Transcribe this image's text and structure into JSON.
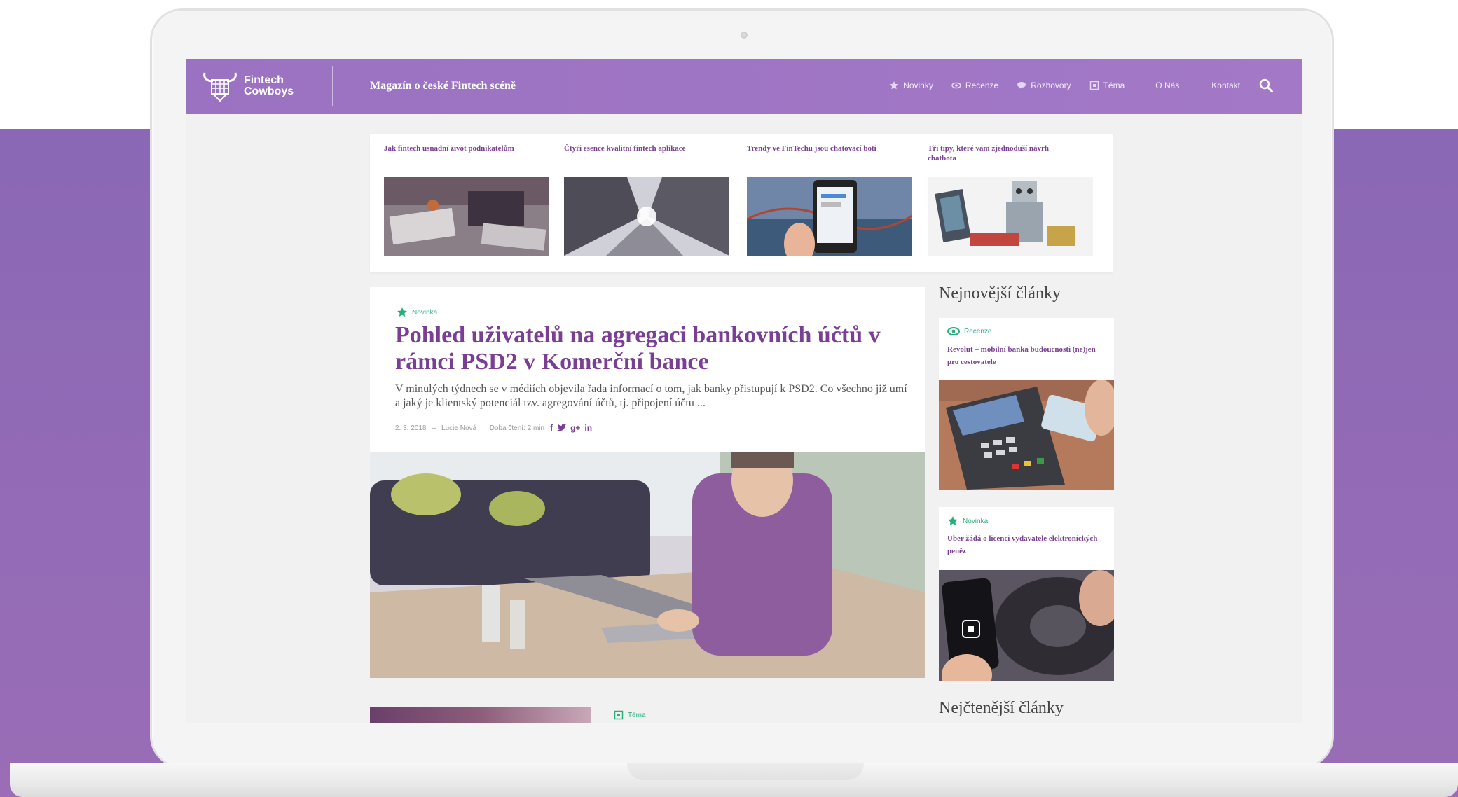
{
  "colors": {
    "brand": "#a076c6",
    "accent_green": "#23b07a",
    "title_purple": "#7a3f94"
  },
  "header": {
    "logo": {
      "line1": "Fintech",
      "line2": "Cowboys",
      "icon": "bull-skull-logo-icon"
    },
    "tagline": "Magazín o české Fintech scéně",
    "nav": [
      {
        "label": "Novinky",
        "icon": "star-icon"
      },
      {
        "label": "Recenze",
        "icon": "eye-icon"
      },
      {
        "label": "Rozhovory",
        "icon": "speech-bubble-icon"
      },
      {
        "label": "Téma",
        "icon": "square-dot-icon"
      },
      {
        "label": "O Nás",
        "icon": ""
      },
      {
        "label": "Kontakt",
        "icon": ""
      }
    ],
    "search_icon": "search-icon"
  },
  "teasers": [
    {
      "title": "Jak fintech usnadní život podnikatelům"
    },
    {
      "title": "Čtyři esence kvalitní fintech aplikace"
    },
    {
      "title": "Trendy ve FinTechu jsou chatovací boti"
    },
    {
      "title": "Tři tipy, které vám zjednoduší návrh chatbota"
    }
  ],
  "main_article": {
    "category": "Novinka",
    "category_icon": "star-icon",
    "title": "Pohled uživatelů na agregaci bankovních účtů v rámci PSD2 v Komerční bance",
    "excerpt": "V minulých týdnech se v médiích objevila řada informací o tom, jak banky přistupují k PSD2. Co všechno již umí a jaký je klientský potenciál tzv. agregování účtů, tj. připojení účtu ...",
    "meta": {
      "date": "2. 3. 2018",
      "author": "Lucie Nová",
      "reading_time": "Doba čtení: 2 min"
    },
    "social": [
      "f",
      "twitter-icon",
      "g+",
      "in"
    ]
  },
  "sidebar": {
    "newest_heading": "Nejnovější články",
    "cards": [
      {
        "category": "Recenze",
        "category_icon": "eye-icon",
        "title": "Revolut – mobilní banka budoucnosti (ne)jen pro cestovatele"
      },
      {
        "category": "Novinka",
        "category_icon": "star-icon",
        "title": "Uber žádá o licenci vydavatele elektronických peněz"
      }
    ],
    "most_read_heading": "Nejčtenější články"
  },
  "bottom": {
    "category": "Téma",
    "category_icon": "square-dot-icon"
  }
}
